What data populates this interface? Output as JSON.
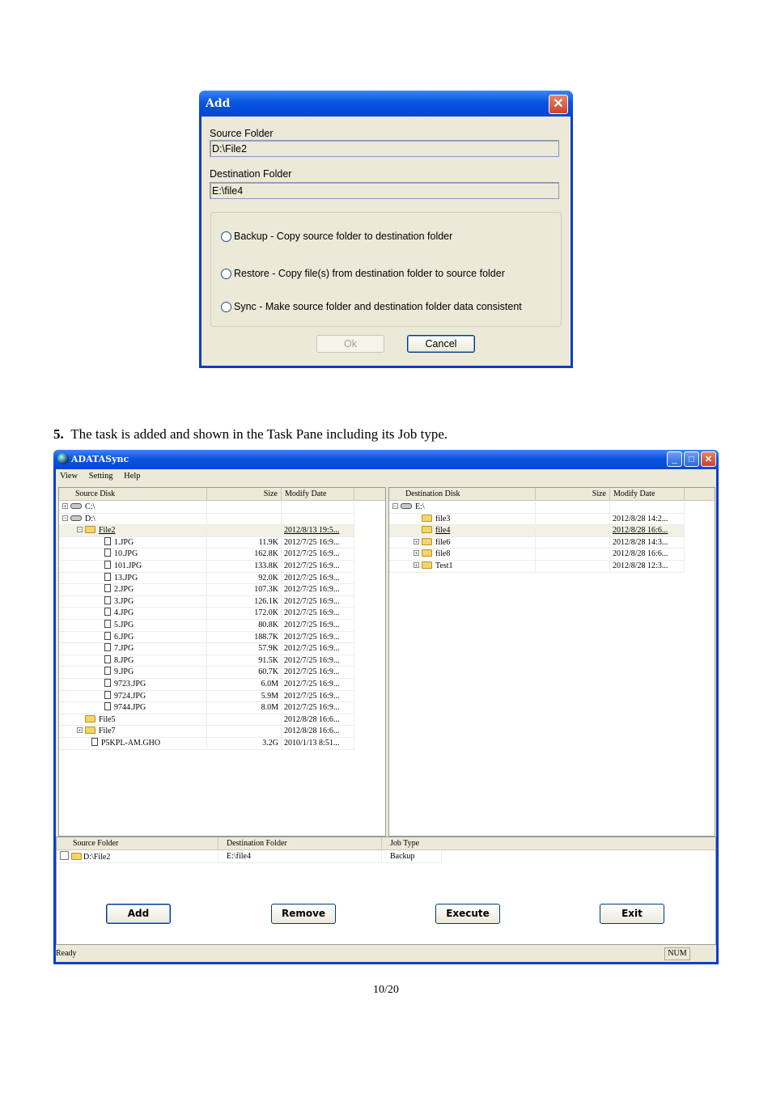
{
  "dialog": {
    "title": "Add",
    "close_glyph": "✕",
    "source_label": "Source Folder",
    "source_value": "D:\\File2",
    "dest_label": "Destination Folder",
    "dest_value": "E:\\file4",
    "options": [
      "Backup - Copy source folder to destination folder",
      "Restore - Copy file(s) from destination folder to source folder",
      "Sync - Make source folder and destination folder data consistent"
    ],
    "ok_label": "Ok",
    "cancel_label": "Cancel"
  },
  "step": {
    "number": "5.",
    "text": "The task is added and shown in the Task Pane including its Job type."
  },
  "window": {
    "title": "ADATASync",
    "menu": [
      "View",
      "Setting",
      "Help"
    ],
    "source_pane": {
      "headers": [
        "Source Disk",
        "Size",
        "Modify Date"
      ],
      "rows": [
        {
          "name": "C:\\",
          "size": "",
          "date": "",
          "kind": "drive",
          "pm": "+"
        },
        {
          "name": "D:\\",
          "size": "",
          "date": "",
          "kind": "drive",
          "pm": "−"
        },
        {
          "name": "File2",
          "size": "",
          "date": "2012/8/13 19:5...",
          "kind": "folder-open",
          "pm": "−",
          "sel": true
        },
        {
          "name": "1.JPG",
          "size": "11.9K",
          "date": "2012/7/25 16:9...",
          "kind": "file"
        },
        {
          "name": "10.JPG",
          "size": "162.8K",
          "date": "2012/7/25 16:9...",
          "kind": "file"
        },
        {
          "name": "101.JPG",
          "size": "133.8K",
          "date": "2012/7/25 16:9...",
          "kind": "file"
        },
        {
          "name": "13.JPG",
          "size": "92.0K",
          "date": "2012/7/25 16:9...",
          "kind": "file"
        },
        {
          "name": "2.JPG",
          "size": "107.3K",
          "date": "2012/7/25 16:9...",
          "kind": "file"
        },
        {
          "name": "3.JPG",
          "size": "126.1K",
          "date": "2012/7/25 16:9...",
          "kind": "file"
        },
        {
          "name": "4.JPG",
          "size": "172.0K",
          "date": "2012/7/25 16:9...",
          "kind": "file"
        },
        {
          "name": "5.JPG",
          "size": "80.8K",
          "date": "2012/7/25 16:9...",
          "kind": "file"
        },
        {
          "name": "6.JPG",
          "size": "188.7K",
          "date": "2012/7/25 16:9...",
          "kind": "file"
        },
        {
          "name": "7.JPG",
          "size": "57.9K",
          "date": "2012/7/25 16:9...",
          "kind": "file"
        },
        {
          "name": "8.JPG",
          "size": "91.5K",
          "date": "2012/7/25 16:9...",
          "kind": "file"
        },
        {
          "name": "9.JPG",
          "size": "60.7K",
          "date": "2012/7/25 16:9...",
          "kind": "file"
        },
        {
          "name": "9723.JPG",
          "size": "6.0M",
          "date": "2012/7/25 16:9...",
          "kind": "file"
        },
        {
          "name": "9724.JPG",
          "size": "5.9M",
          "date": "2012/7/25 16:9...",
          "kind": "file"
        },
        {
          "name": "9744.JPG",
          "size": "8.0M",
          "date": "2012/7/25 16:9...",
          "kind": "file"
        },
        {
          "name": "File5",
          "size": "",
          "date": "2012/8/28 16:6...",
          "kind": "folder"
        },
        {
          "name": "File7",
          "size": "",
          "date": "2012/8/28 16:6...",
          "kind": "folder",
          "pm": "+"
        },
        {
          "name": "P5KPL-AM.GHO",
          "size": "3.2G",
          "date": "2010/1/13 8:51...",
          "kind": "file"
        }
      ]
    },
    "dest_pane": {
      "headers": [
        "Destination Disk",
        "Size",
        "Modify Date"
      ],
      "rows": [
        {
          "name": "E:\\",
          "size": "",
          "date": "",
          "kind": "drive",
          "pm": "−"
        },
        {
          "name": "file3",
          "size": "",
          "date": "2012/8/28 14:2...",
          "kind": "folder"
        },
        {
          "name": "file4",
          "size": "",
          "date": "2012/8/28 16:6...",
          "kind": "folder-open",
          "sel": true
        },
        {
          "name": "file6",
          "size": "",
          "date": "2012/8/28 14:3...",
          "kind": "folder",
          "pm": "+"
        },
        {
          "name": "file8",
          "size": "",
          "date": "2012/8/28 16:6...",
          "kind": "folder",
          "pm": "+"
        },
        {
          "name": "Test1",
          "size": "",
          "date": "2012/8/28 12:3...",
          "kind": "folder",
          "pm": "+"
        }
      ]
    },
    "task_pane": {
      "headers": [
        "Source Folder",
        "Destination Folder",
        "Job Type"
      ],
      "rows": [
        {
          "source": "D:\\File2",
          "dest": "E:\\file4",
          "job": "Backup"
        }
      ]
    },
    "buttons": [
      "Add",
      "Remove",
      "Execute",
      "Exit"
    ],
    "status_left": "Ready",
    "status_right": "NUM"
  },
  "page_number": "10/20"
}
